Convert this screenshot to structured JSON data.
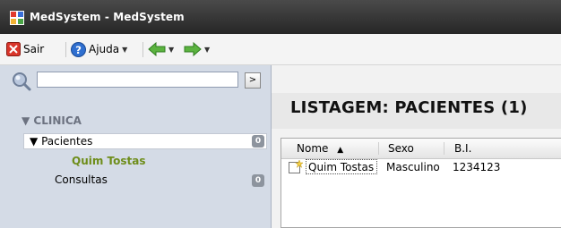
{
  "window": {
    "title": "MedSystem - MedSystem"
  },
  "toolbar": {
    "exit_label": "Sair",
    "help_label": "Ajuda"
  },
  "sidebar": {
    "search": {
      "value": "",
      "placeholder": ""
    },
    "go_glyph": ">",
    "section_label": "CLINICA",
    "items": [
      {
        "label": "Pacientes",
        "count": "0",
        "expanded": true,
        "selected": true,
        "children": [
          "Quim Tostas"
        ]
      },
      {
        "label": "Consultas",
        "count": "0"
      }
    ],
    "tree_expanded_glyph": "▼"
  },
  "main": {
    "heading": "LISTAGEM: PACIENTES (1)",
    "table": {
      "columns": [
        "Nome",
        "Sexo",
        "B.I."
      ],
      "sort_glyph": "▲",
      "rows": [
        {
          "nome": "Quim Tostas",
          "sexo": "Masculino",
          "bi": "1234123"
        }
      ]
    }
  },
  "colors": {
    "titlebar": "#262626",
    "sidebar_bg": "#d4dbe6",
    "child_text": "#6e8d1a",
    "badge": "#8d949e"
  }
}
